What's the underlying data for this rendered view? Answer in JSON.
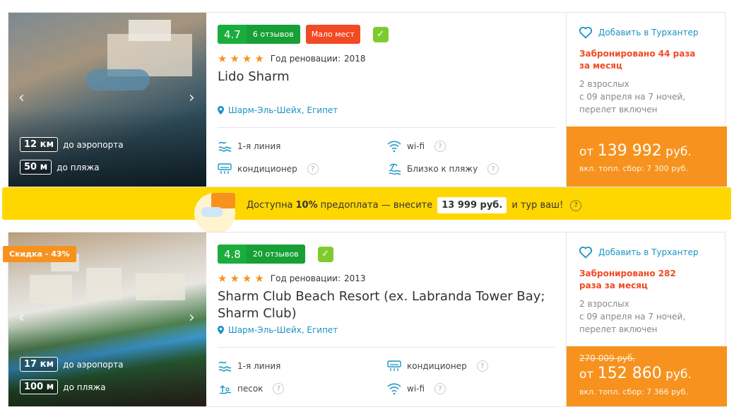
{
  "hotels": [
    {
      "rating": "4.7",
      "reviews": "6 отзывов",
      "few_places": "Мало мест",
      "renovation_label": "Год реновации:",
      "renovation_year": "2018",
      "name": "Lido Sharm",
      "location": "Шарм-Эль-Шейх, Египет",
      "airport_km": "12 км",
      "airport_label": "до аэропорта",
      "beach_m": "50 м",
      "beach_label": "до пляжа",
      "features": [
        {
          "label": "1-я линия",
          "icon": "waves-icon"
        },
        {
          "label": "wi-fi",
          "icon": "wifi-icon"
        },
        {
          "label": "кондиционер",
          "icon": "ac-icon"
        },
        {
          "label": "Близко к пляжу",
          "icon": "beach-icon"
        }
      ],
      "favorite": "Добавить в Турхантер",
      "booked": "Забронировано 44 раза за месяц",
      "guests": "2 взрослых",
      "dates": "с 09 апреля на 7 ночей,",
      "flight": "перелет включен",
      "price_prefix": "от",
      "price": "139 992",
      "currency": "руб.",
      "tax": "вкл. топл. сбор: 7 300 руб."
    },
    {
      "discount": "Скидка - 43%",
      "rating": "4.8",
      "reviews": "20 отзывов",
      "renovation_label": "Год реновации:",
      "renovation_year": "2013",
      "name": "Sharm Club Beach Resort (ex. Labranda Tower Bay; Sharm Club)",
      "location": "Шарм-Эль-Шейх, Египет",
      "airport_km": "17 км",
      "airport_label": "до аэропорта",
      "beach_m": "100 м",
      "beach_label": "до пляжа",
      "features": [
        {
          "label": "1-я линия",
          "icon": "waves-icon"
        },
        {
          "label": "кондиционер",
          "icon": "ac-icon"
        },
        {
          "label": "песок",
          "icon": "sand-icon"
        },
        {
          "label": "wi-fi",
          "icon": "wifi-icon"
        }
      ],
      "favorite": "Добавить в Турхантер",
      "booked": "Забронировано 282 раза за месяц",
      "guests": "2 взрослых",
      "dates": "с 09 апреля на 7 ночей,",
      "flight": "перелет включен",
      "old_price": "270 009 руб.",
      "price_prefix": "от",
      "price": "152 860",
      "currency": "руб.",
      "tax": "вкл. топл. сбор: 7 366 руб."
    }
  ],
  "banner": {
    "text1": "Доступна",
    "percent": "10%",
    "text2": "предоплата — внесите",
    "amount": "13 999 руб.",
    "text3": "и тур ваш!"
  },
  "colors": {
    "rating_green": "#1aad3d",
    "accent_orange": "#f7921e",
    "alert_red": "#f24a24",
    "link_blue": "#1a93c5",
    "banner_yellow": "#ffd700"
  }
}
